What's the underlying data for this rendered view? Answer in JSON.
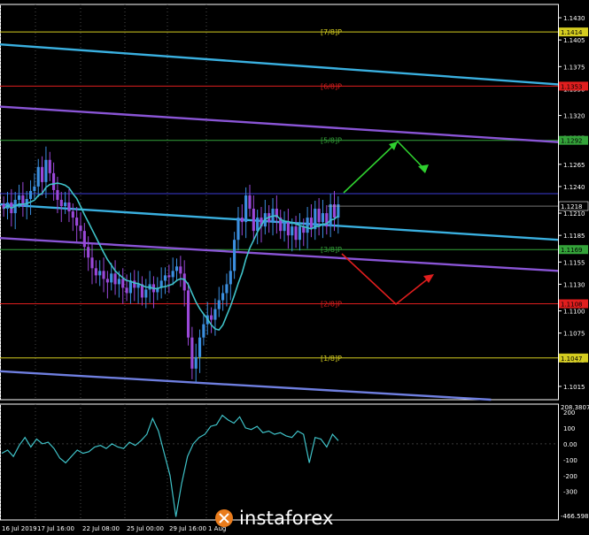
{
  "chart_data": [
    {
      "type": "candlestick",
      "price_axis_ticks": [
        "1.1430",
        "1.1405",
        "1.1375",
        "1.1350",
        "1.1320",
        "1.1295",
        "1.1265",
        "1.1240",
        "1.1210",
        "1.1185",
        "1.1155",
        "1.1130",
        "1.1100",
        "1.1075",
        "1.1045",
        "1.1015"
      ],
      "ylim": [
        1.1,
        1.1445
      ],
      "time_axis_ticks": [
        "16 Jul 2019",
        "17 Jul 16:00",
        "22 Jul 08:00",
        "25 Jul 00:00",
        "29 Jul 16:00",
        "1 Aug"
      ],
      "murrey_levels": [
        {
          "label": "[7/8]P",
          "price": 1.1414,
          "tag": "1.1414",
          "color": "#d4cc20"
        },
        {
          "label": "[6/8]P",
          "price": 1.1353,
          "tag": "1.1353",
          "color": "#e01e1e"
        },
        {
          "label": "[5/8]P",
          "price": 1.1292,
          "tag": "1.1292",
          "color": "#34a33a"
        },
        {
          "label": "",
          "price": 1.1232,
          "tag": "",
          "color": "#3b3bd6"
        },
        {
          "label": "[3/8]P",
          "price": 1.1169,
          "tag": "1.1169",
          "color": "#34a33a"
        },
        {
          "label": "[2/8]P",
          "price": 1.1108,
          "tag": "1.1108",
          "color": "#e01e1e"
        },
        {
          "label": "[1/8]P",
          "price": 1.1047,
          "tag": "1.1047",
          "color": "#d4cc20"
        }
      ],
      "current_price": "1.1218",
      "closes": [
        1.1215,
        1.1222,
        1.121,
        1.1225,
        1.123,
        1.1218,
        1.1226,
        1.1235,
        1.124,
        1.1262,
        1.1245,
        1.127,
        1.1255,
        1.1236,
        1.1225,
        1.1218,
        1.1222,
        1.1212,
        1.1205,
        1.1196,
        1.119,
        1.1172,
        1.116,
        1.1148,
        1.114,
        1.1145,
        1.1136,
        1.1132,
        1.1142,
        1.113,
        1.1136,
        1.1126,
        1.112,
        1.1134,
        1.1126,
        1.113,
        1.1115,
        1.1124,
        1.113,
        1.1121,
        1.1126,
        1.1134,
        1.114,
        1.1138,
        1.1145,
        1.115,
        1.1142,
        1.1123,
        1.107,
        1.1035,
        1.1048,
        1.107,
        1.1085,
        1.1095,
        1.109,
        1.1102,
        1.1112,
        1.112,
        1.113,
        1.1145,
        1.118,
        1.1205,
        1.12,
        1.123,
        1.1215,
        1.119,
        1.1205,
        1.1195,
        1.121,
        1.12,
        1.1215,
        1.1205,
        1.119,
        1.12,
        1.1185,
        1.1195,
        1.118,
        1.1195,
        1.1188,
        1.1205,
        1.1192,
        1.1215,
        1.12,
        1.121,
        1.1195,
        1.122,
        1.1205,
        1.122
      ],
      "series": [
        {
          "name": "",
          "role": "moving_average",
          "color": "#3fc2c8"
        }
      ],
      "channels": [
        {
          "role": "upper_channel",
          "color": "#3ab0e0",
          "points": [
            [
              0,
              1.14
            ],
            [
              1,
              1.1355
            ]
          ]
        },
        {
          "role": "middle_channel",
          "color": "#3ab0e0",
          "points": [
            [
              0,
              1.122
            ],
            [
              1,
              1.118
            ]
          ]
        },
        {
          "role": "upper_violet",
          "color": "#8a55d6",
          "points": [
            [
              0,
              1.133
            ],
            [
              1,
              1.129
            ]
          ]
        },
        {
          "role": "lower_violet",
          "color": "#8a55d6",
          "points": [
            [
              0,
              1.1182
            ],
            [
              1,
              1.1145
            ]
          ]
        },
        {
          "role": "lower_channel",
          "color": "#6f7fe0",
          "points": [
            [
              0,
              1.1032
            ],
            [
              0.88,
              1.1
            ]
          ]
        }
      ],
      "arrows": [
        {
          "color": "#2fd02f",
          "direction": "up-then-down"
        },
        {
          "color": "#e01e1e",
          "direction": "down-then-up"
        }
      ]
    },
    {
      "type": "line",
      "indicator_value": "208.3807",
      "indicator_min": "-466.5986",
      "y_ticks": [
        "200",
        "100",
        "0.00",
        "-100",
        "-200",
        "-300"
      ],
      "ylim": [
        -480,
        250
      ],
      "color": "#3fc2c8",
      "values": [
        -60,
        -40,
        -80,
        -10,
        40,
        -20,
        30,
        0,
        10,
        -30,
        -90,
        -120,
        -80,
        -40,
        -60,
        -50,
        -20,
        -10,
        -30,
        0,
        -20,
        -30,
        10,
        -10,
        20,
        60,
        160,
        80,
        -60,
        -200,
        -460,
        -250,
        -80,
        0,
        40,
        60,
        110,
        120,
        180,
        150,
        130,
        170,
        100,
        90,
        110,
        70,
        80,
        60,
        70,
        50,
        40,
        80,
        60,
        -120,
        40,
        30,
        -20,
        60,
        20
      ]
    }
  ],
  "watermark": {
    "text": "instaforex"
  }
}
